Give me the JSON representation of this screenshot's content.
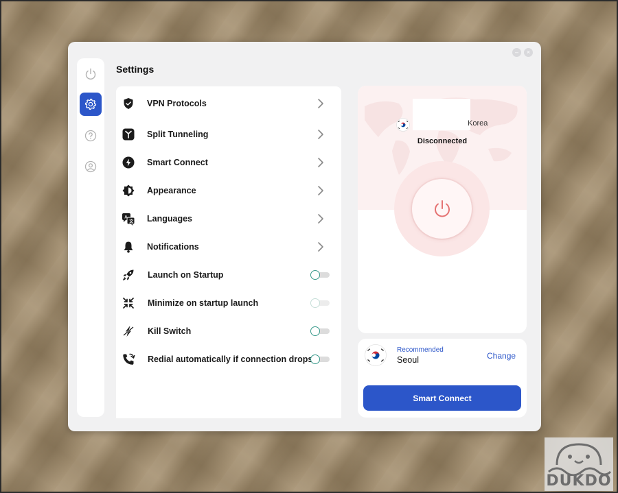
{
  "window": {
    "controls": [
      "minimize",
      "close"
    ]
  },
  "sidebar": {
    "items": [
      {
        "name": "power",
        "icon": "power-icon",
        "active": false
      },
      {
        "name": "settings",
        "icon": "gear-icon",
        "active": true
      },
      {
        "name": "help",
        "icon": "help-icon",
        "active": false
      },
      {
        "name": "account",
        "icon": "user-icon",
        "active": false
      }
    ]
  },
  "settings": {
    "title": "Settings",
    "items": [
      {
        "label": "VPN Protocols",
        "icon": "shield-icon",
        "control": "chevron"
      },
      {
        "label": "Split Tunneling",
        "icon": "split-icon",
        "control": "chevron"
      },
      {
        "label": "Smart Connect",
        "icon": "bolt-icon",
        "control": "chevron"
      },
      {
        "label": "Appearance",
        "icon": "appearance-icon",
        "control": "chevron"
      },
      {
        "label": "Languages",
        "icon": "languages-icon",
        "control": "chevron"
      },
      {
        "label": "Notifications",
        "icon": "bell-icon",
        "control": "chevron"
      },
      {
        "label": "Launch on Startup",
        "icon": "rocket-icon",
        "control": "toggle",
        "on": false
      },
      {
        "label": "Minimize on startup launch",
        "icon": "minimize-icon",
        "control": "toggle",
        "on": false,
        "disabled": true
      },
      {
        "label": "Kill Switch",
        "icon": "kill-switch-icon",
        "control": "toggle",
        "on": false
      },
      {
        "label": "Redial automatically if connection drops",
        "icon": "phone-icon",
        "control": "toggle",
        "on": false
      }
    ]
  },
  "connection": {
    "location_suffix": "Korea",
    "flag": "south-korea-flag",
    "status": "Disconnected"
  },
  "recommended": {
    "label": "Recommended",
    "city": "Seoul",
    "change_label": "Change",
    "flag": "south-korea-flag"
  },
  "smart_connect_button": "Smart Connect",
  "watermark": {
    "text": "DUKDO"
  },
  "colors": {
    "accent": "#2c56c9",
    "toggle_border": "#3a9b8c",
    "power_icon": "#e57373",
    "connection_bg": "#fcf1f1"
  }
}
